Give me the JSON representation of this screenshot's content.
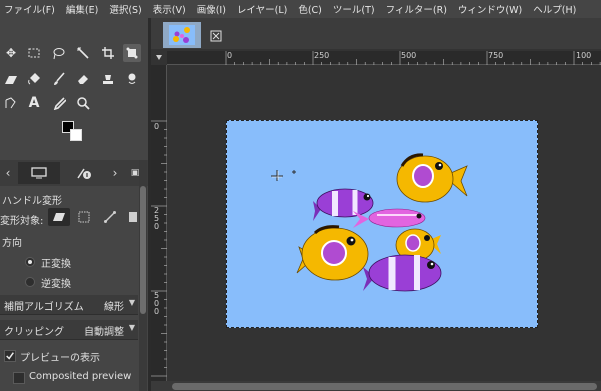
{
  "menu": [
    "ファイル(F)",
    "編集(E)",
    "選択(S)",
    "表示(V)",
    "画像(I)",
    "レイヤー(L)",
    "色(C)",
    "ツール(T)",
    "フィルター(R)",
    "ウィンドウ(W)",
    "ヘルプ(H)"
  ],
  "tool_options": {
    "title": "ハンドル変形",
    "transform_label": "変形対象:",
    "direction_label": "方向",
    "direction_forward": "正変換",
    "direction_backward": "逆変換",
    "interpolation_label": "補間アルゴリズム",
    "interpolation_value": "線形",
    "clipping_label": "クリッピング",
    "clipping_value": "自動調整",
    "show_preview": "プレビューの表示",
    "composited_preview": "Composited preview"
  },
  "ruler": {
    "h_labels": [
      "0",
      "250",
      "500",
      "750",
      "100"
    ],
    "v_labels": [
      [
        "0"
      ],
      [
        "2",
        "5",
        "0"
      ],
      [
        "5",
        "0",
        "0"
      ]
    ]
  },
  "colors": {
    "canvas_bg": "#88bdfb",
    "fish_yellow": "#f5b800",
    "fish_purple": "#9a3fd6",
    "fish_pink": "#e264e0"
  }
}
